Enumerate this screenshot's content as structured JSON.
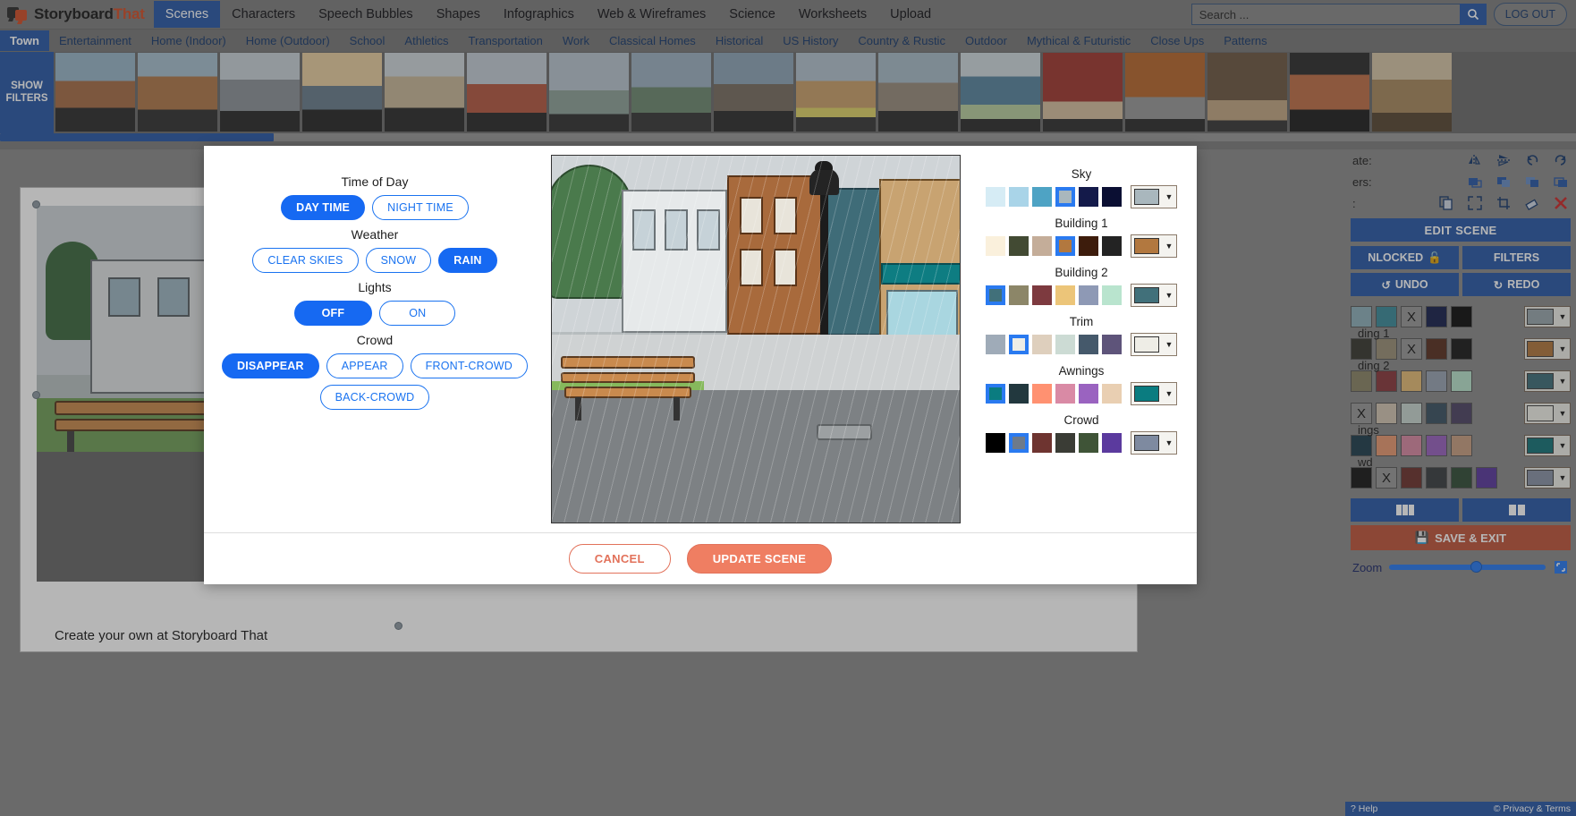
{
  "header": {
    "brand_primary": "Storyboard",
    "brand_accent": "That",
    "nav": [
      {
        "label": "Scenes",
        "active": true
      },
      {
        "label": "Characters",
        "active": false
      },
      {
        "label": "Speech Bubbles",
        "active": false
      },
      {
        "label": "Shapes",
        "active": false
      },
      {
        "label": "Infographics",
        "active": false
      },
      {
        "label": "Web & Wireframes",
        "active": false
      },
      {
        "label": "Science",
        "active": false
      },
      {
        "label": "Worksheets",
        "active": false
      },
      {
        "label": "Upload",
        "active": false
      }
    ],
    "search_placeholder": "Search ...",
    "search_value": "",
    "search_icon": "search-icon",
    "logout_label": "LOG OUT"
  },
  "categories": [
    {
      "label": "Town",
      "active": true
    },
    {
      "label": "Entertainment",
      "active": false
    },
    {
      "label": "Home (Indoor)",
      "active": false
    },
    {
      "label": "Home (Outdoor)",
      "active": false
    },
    {
      "label": "School",
      "active": false
    },
    {
      "label": "Athletics",
      "active": false
    },
    {
      "label": "Transportation",
      "active": false
    },
    {
      "label": "Work",
      "active": false
    },
    {
      "label": "Classical Homes",
      "active": false
    },
    {
      "label": "Historical",
      "active": false
    },
    {
      "label": "US History",
      "active": false
    },
    {
      "label": "Country & Rustic",
      "active": false
    },
    {
      "label": "Outdoor",
      "active": false
    },
    {
      "label": "Mythical & Futuristic",
      "active": false
    },
    {
      "label": "Close Ups",
      "active": false
    },
    {
      "label": "Patterns",
      "active": false
    }
  ],
  "show_filters_label": "SHOW\nFILTERS",
  "canvas": {
    "caption": "Create your own at Storyboard That"
  },
  "modal": {
    "options": [
      {
        "title": "Time of Day",
        "name": "time-of-day",
        "buttons": [
          {
            "label": "DAY TIME",
            "selected": true
          },
          {
            "label": "NIGHT TIME",
            "selected": false
          }
        ]
      },
      {
        "title": "Weather",
        "name": "weather",
        "buttons": [
          {
            "label": "CLEAR SKIES",
            "selected": false
          },
          {
            "label": "SNOW",
            "selected": false
          },
          {
            "label": "RAIN",
            "selected": true
          }
        ]
      },
      {
        "title": "Lights",
        "name": "lights",
        "buttons": [
          {
            "label": "OFF",
            "selected": true
          },
          {
            "label": "ON",
            "selected": false
          }
        ]
      },
      {
        "title": "Crowd",
        "name": "crowd",
        "buttons": [
          {
            "label": "DISAPPEAR",
            "selected": true
          },
          {
            "label": "APPEAR",
            "selected": false
          },
          {
            "label": "FRONT-CROWD",
            "selected": false
          },
          {
            "label": "BACK-CROWD",
            "selected": false
          }
        ]
      }
    ],
    "color_groups": [
      {
        "title": "Sky",
        "name": "sky",
        "swatches": [
          "#d6ecf5",
          "#a9d4e8",
          "#4ea3c4",
          "#a9b7bd",
          "#141a4a",
          "#0b0f33"
        ],
        "selected_index": 3,
        "current": "#a9b7bd"
      },
      {
        "title": "Building 1",
        "name": "building-1",
        "swatches": [
          "#faf0dc",
          "#424a33",
          "#c4ad99",
          "#b2783f",
          "#3d1c0c",
          "#232323"
        ],
        "selected_index": 3,
        "current": "#b2783f"
      },
      {
        "title": "Building 2",
        "name": "building-2",
        "swatches": [
          "#41707a",
          "#8c8668",
          "#7d3a3f",
          "#ecc579",
          "#8e99b5",
          "#b9e4ce"
        ],
        "selected_index": 0,
        "current": "#41707a"
      },
      {
        "title": "Trim",
        "name": "trim",
        "swatches": [
          "#9fabb8",
          "#eeede6",
          "#decfbd",
          "#ccdbd4",
          "#45596b",
          "#5e547a"
        ],
        "selected_index": 1,
        "current": "#eeede6"
      },
      {
        "title": "Awnings",
        "name": "awnings",
        "swatches": [
          "#0a7c80",
          "#22383e",
          "#ff9171",
          "#d98aa5",
          "#9a63c0",
          "#e9cfb2"
        ],
        "selected_index": 0,
        "current": "#0a7c80"
      },
      {
        "title": "Crowd",
        "name": "crowd-colors",
        "swatches": [
          "#000000",
          "#6e7a8a",
          "#6e3430",
          "#3a3c35",
          "#3f5437",
          "#5b3a9e"
        ],
        "selected_index": 1,
        "current": "#7e8aa0"
      }
    ],
    "cancel_label": "CANCEL",
    "update_label": "UPDATE SCENE"
  },
  "sidebar": {
    "rotate_label": "ate:",
    "layers_label": "ers:",
    "third_label": ":",
    "rotate_icons": [
      "flip-horizontal-icon",
      "flip-vertical-icon",
      "rotate-left-icon",
      "rotate-right-icon"
    ],
    "layer_icons": [
      "send-to-back-icon",
      "send-backward-icon",
      "bring-forward-icon",
      "bring-to-front-icon"
    ],
    "tool_icons": [
      "copy-icon",
      "expand-icon",
      "crop-icon",
      "eraser-icon",
      "delete-icon"
    ],
    "edit_scene_label": "EDIT SCENE",
    "unlocked_label": "NLOCKED",
    "filters_label": "FILTERS",
    "undo_label": "UNDO",
    "redo_label": "REDO",
    "color_rows": [
      {
        "label": "",
        "swatches": [
          "#8fb0bb",
          "#3e8c9c",
          "#X",
          "#1b2450",
          "#111111"
        ],
        "selected_index": 2,
        "current": "#9aa7ad",
        "x_index": 2
      },
      {
        "label": "ding 1",
        "swatches": [
          "#3b3b33",
          "#9b9178",
          "#X",
          "#5b3324",
          "#1d1d1d"
        ],
        "selected_index": 2,
        "current": "#b2783f",
        "x_index": 2
      },
      {
        "label": "ding 2",
        "swatches": [
          "#8c8668",
          "#8a3a3f",
          "#e6bd77",
          "#9aa4b4",
          "#b9e4ce"
        ],
        "selected_index": -1,
        "current": "#41707a",
        "x_index": -1
      },
      {
        "label": "",
        "swatches": [
          "#X",
          "#d3c6b3",
          "#c8d6d0",
          "#3e5464",
          "#4f4767"
        ],
        "selected_index": 0,
        "current": "#f2f1ea",
        "x_index": 0
      },
      {
        "label": "ings",
        "swatches": [
          "#22414f",
          "#e89a72",
          "#d98aa5",
          "#9a63c0",
          "#c9a083"
        ],
        "selected_index": -1,
        "current": "#17767a",
        "x_index": -1
      },
      {
        "label": "wd",
        "swatches": [
          "#1a1a1a",
          "#X",
          "#6e3430",
          "#3c4044",
          "#35503a",
          "#5b3a9e"
        ],
        "selected_index": 1,
        "current": "#8b94a8",
        "x_index": 1
      }
    ],
    "view_icons": [
      "grid-view-icon",
      "column-view-icon"
    ],
    "save_label": "SAVE & EXIT",
    "save_icon": "save-icon",
    "zoom_label": "Zoom",
    "zoom_value": 52,
    "fit_icon": "fit-screen-icon",
    "help_label": "Help",
    "help_icon": "help-icon",
    "copyright_label": "© Privacy & Terms"
  },
  "colors": {
    "brand_blue": "#2b5aa8",
    "pill_blue": "#1669f2",
    "accent_orange": "#ef7e62",
    "brand_red": "#d2502a"
  }
}
